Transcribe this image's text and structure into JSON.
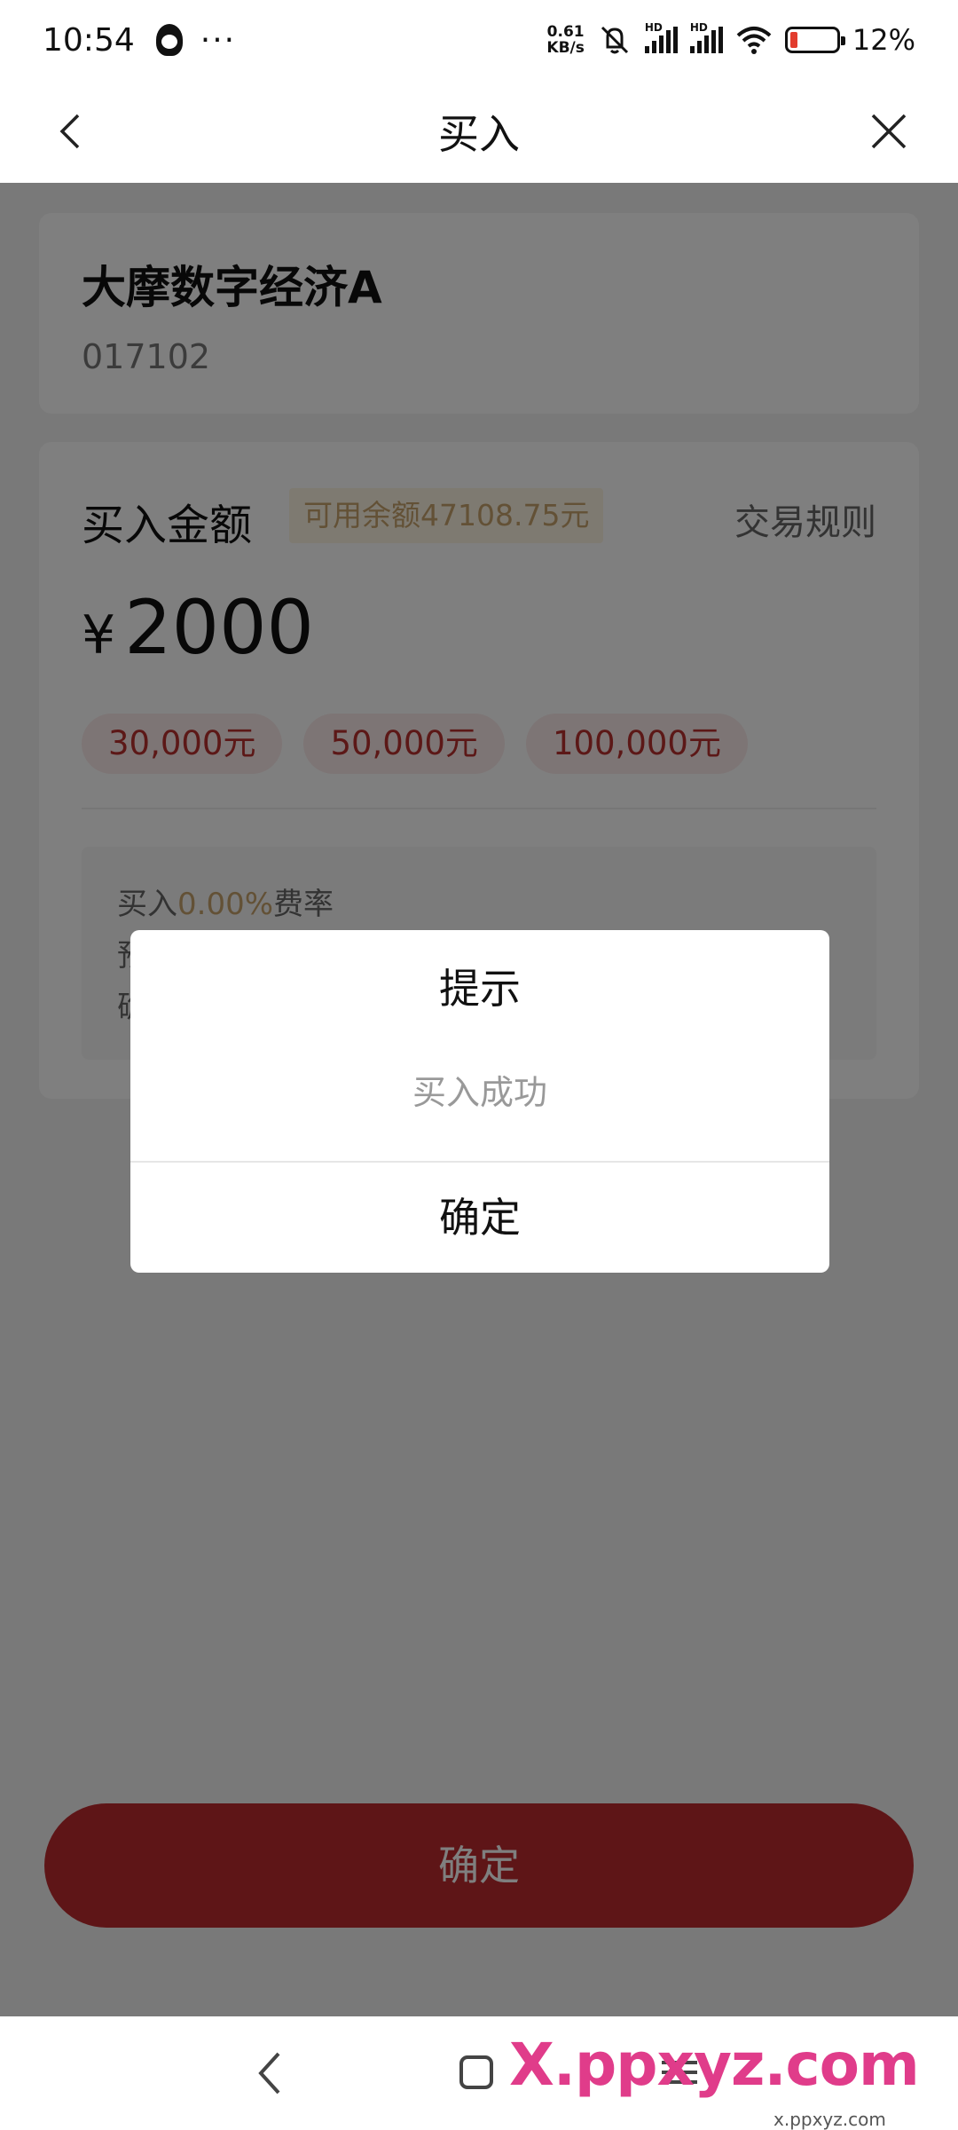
{
  "status_bar": {
    "time": "10:54",
    "speed_value": "0.61",
    "speed_unit": "KB/s",
    "battery_percent": "12%",
    "network_label": "HD",
    "icons": [
      "qq-icon",
      "more-dots-icon",
      "mute-bell-icon",
      "signal-icon",
      "signal-icon",
      "wifi-icon",
      "battery-icon"
    ],
    "more_glyph": "···"
  },
  "nav": {
    "title": "买入",
    "icons": [
      "back-chevron-icon",
      "close-icon"
    ]
  },
  "fund": {
    "name": "大摩数字经济A",
    "code": "017102"
  },
  "purchase": {
    "amount_label": "买入金额",
    "available_balance": "可用余额47108.75元",
    "rules_link": "交易规则",
    "currency_symbol": "¥",
    "amount_value": "2000",
    "quick_amounts": [
      "30,000元",
      "50,000元",
      "100,000元"
    ],
    "fee_prefix": "买入",
    "fee_rate": "0.00%",
    "fee_suffix": "费率",
    "fee_row2_start": "预",
    "fee_row3_start": "确"
  },
  "confirm_button": "确定",
  "dialog": {
    "title": "提示",
    "message": "买入成功",
    "ok_label": "确定"
  },
  "system_nav": {
    "icons": [
      "back-icon",
      "home-icon",
      "recents-icon"
    ]
  },
  "watermark": {
    "logo_text": "X.ppxyz.com",
    "sub_text": "x.ppxyz.com"
  },
  "colors": {
    "brand_red": "#bd2b2f",
    "chip_bg": "#fbeaea",
    "gold": "#c7a36c",
    "overlay": "rgba(0,0,0,0.5)"
  }
}
